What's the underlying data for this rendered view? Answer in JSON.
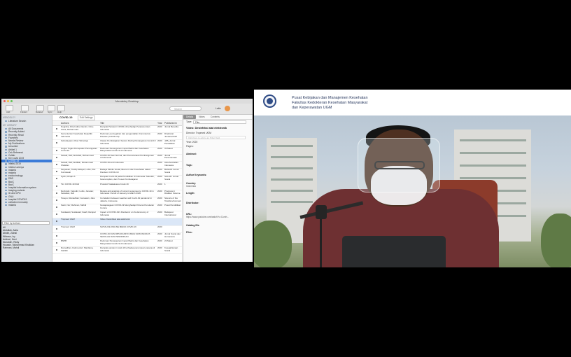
{
  "mendeley": {
    "window_title": "Mendeley Desktop",
    "toolbar": {
      "buttons": [
        "Add",
        "Folders",
        "Related",
        "Sync",
        "Help"
      ],
      "search_placeholder": "Search",
      "user_name": "Laila"
    },
    "sidebar": {
      "header": "MENDELEY",
      "literature_search": "Literature Search",
      "library_header": "MY LIBRARY",
      "library_items": [
        "All Documents",
        "Recently Added",
        "Recently Read",
        "Favorites",
        "Needs Review",
        "My Publications",
        "Unsorted"
      ],
      "folders": [
        "Artikel 1",
        "Cek Referensi",
        "Collab",
        "KD Covid 2019",
        "COVID-19",
        "Infeksi 2019",
        "Infeksi Lainnya",
        "malaria",
        "malaria",
        "endocrinology",
        "DBD",
        "BacC",
        "BacC",
        "hospital information system",
        "imaging malaria",
        "ID and CPD",
        "GNU",
        "hospital COVID19",
        "collective immunity",
        "malaria"
      ],
      "selected_folder_index": 4,
      "filter_label": "Filter by Authors",
      "authors_header": "All",
      "authors": [
        "Abdullah, Aulia",
        "Abidin, Zainal",
        "Wibowo, Ivy",
        "Antinori, Novi",
        "Nuruddin, Ricky",
        "Hussain, Muhammad Khalidan",
        "Rahman, Mahdi"
      ]
    },
    "main": {
      "collection_title": "COVID-19",
      "edit_settings": "Edit Settings",
      "columns": [
        "Authors",
        "Title",
        "Year",
        "Published In"
      ],
      "rows": [
        {
          "authors": "Nugraha, Dita Indria; Damini, Citra; Utara, Muhammad",
          "title": "Dampak Pandemi COVID-19 terhadap Perekonomian Indonesia",
          "year": "2020",
          "pub": "Jurnal Benefita"
        },
        {
          "authors": "Kementerian Kesehatan Republik Indonesia",
          "title": "Pedoman pencegahan dan pengendalian Coronavirus Disease (COVID-19)",
          "year": "2020",
          "pub": "Direktorat Jenderal P2P"
        },
        {
          "authors": "Kebudayaan, Riset Teknologi",
          "title": "Ulasan Pembelajaran Secara Daring Penanganan Covid-19 Indonesia",
          "year": "2020",
          "pub": "JAB_Jurnal Pendidikan"
        },
        {
          "authors": "Gugus Tugas Percepatan Penanganan Covid-19",
          "title": "Pedoman Penanganan Cepat Medis dan Kesehatan Masyarakat Covid-19 di Indonesia",
          "year": "2020",
          "pub": "33 Maret"
        },
        {
          "authors": "Setiadi, Didi; Abdullah, Muhammad",
          "title": "COVID-19 New Normal, dan Perencanaan Pembangunan di Indonesia",
          "year": "2020",
          "pub": "Jurnal Perencanaan"
        },
        {
          "authors": "Setiadi, Didi; Abdillah, Muhammad Khalidan",
          "title": "COVID-19 and Indonesia",
          "year": "2020",
          "pub": "Asia Australian Indonesia"
        },
        {
          "authors": "Setyawan, Taufiq Hidayat; Lubis, Dwi Kurniawati",
          "title": "Budaya Mobile Sosial, Ekonomi dan Kesehatan dalam Pandemi COVID-19",
          "year": "2020",
          "pub": "BAGIAN Jurnal Sosial"
        },
        {
          "authors": "Syah, Rizqan A",
          "title": "Dampak Covid-19 pada Pendidikan di Indonesia: Sekolah, Keterampilan, dan Proses Pembelajaran",
          "year": "2020",
          "pub": "SALAM: Jurnal Sosial"
        },
        {
          "authors": "Tim COVID-19 IDAI",
          "title": "Protokol Tatalaksana Covid-19",
          "year": "2020",
          "pub": "1"
        },
        {
          "authors": "Rezkiyah, Fajrudin; Lubis, Jonatan; Setiawan, Dwi",
          "title": "Review and analysis of current responses to COVID-19 in Indonesia: Period of January to March 2020",
          "year": "2020",
          "pub": "Progress in Disaster Science"
        },
        {
          "authors": "Tosepu, Ramadhan; Gunawan, Joko",
          "title": "Correlation between weather and Covid-19 pandemic in Jakarta, Indonesia",
          "year": "2020",
          "pub": "Science of the Total Environment"
        },
        {
          "authors": "Santi, Nur; Rahman, Mahdi",
          "title": "Kesiapsiagaan COVID-19 Menghadapi Potensi Penularan Corona",
          "year": "2020",
          "pub": "Pusat Pendidikan"
        },
        {
          "authors": "Susilawati, Susilawati; Falefi, Reinpal",
          "title": "Impact of COVID-19's Pandemic on the Economy of Indonesia",
          "year": "2020",
          "pub": "Budapest International"
        },
        {
          "authors": "Tropmed UGM",
          "title": "Video: Desinfeksi alat elektronik",
          "year": "",
          "pub": ""
        },
        {
          "authors": "Tropmed UGM",
          "title": "SATIALIKE ONLINE MEDIA COVID-19",
          "year": "2020",
          "pub": ""
        },
        {
          "authors": "",
          "title": "COVID-19 DAN IMPLIKASINYA BAGI MASYARAKAT, SEKOLAH DAN PENDIDIKAN",
          "year": "2020",
          "pub": "Jurnal Sosial dan Humaniora"
        },
        {
          "authors": "BNPB",
          "title": "Pedoman Penanganan Cepat Medis dan Kesehatan Masyarakat Covid-19 di Indonesia",
          "year": "2020",
          "pub": "22 Maret"
        },
        {
          "authors": "Ramadhan, Fatima Asri; Mardiana, Fadilah",
          "title": "Dampak pandemi covid-19 terhadap perempuan pekerja di Indonesia",
          "year": "2020",
          "pub": "Kesejahteraan Sosial"
        }
      ],
      "selected_row_index": 13
    },
    "details": {
      "tabs": [
        "Details",
        "Notes",
        "Contents"
      ],
      "type_label": "Type:",
      "type_value": "Film",
      "doc_title": "Video: Desinfeksi alat elektronik",
      "director_label": "Director:",
      "director_value": "Tropmed UGM",
      "add_placeholder": "Click here to add to an 'Filter' field",
      "year_label": "Year:",
      "year_value": "2020",
      "pages_label": "Pages:",
      "fields": [
        "Abstract:",
        "Tags:",
        "Author Keywords:",
        "Country:",
        "Length:",
        "Distributor:"
      ],
      "country_value": "Indonesia",
      "url_label": "URL:",
      "url_value": "https://www.youtube.com/watch?v=Cumh...",
      "catalog_label": "Catalog IDs",
      "files_label": "Files:"
    }
  },
  "webcam": {
    "header_lines": [
      "Pusat Kebijakan dan Manajemen Kesehatan",
      "Fakultas Kedokteran Kesehatan Masyarakat",
      "dan Keperawatan UGM"
    ]
  }
}
